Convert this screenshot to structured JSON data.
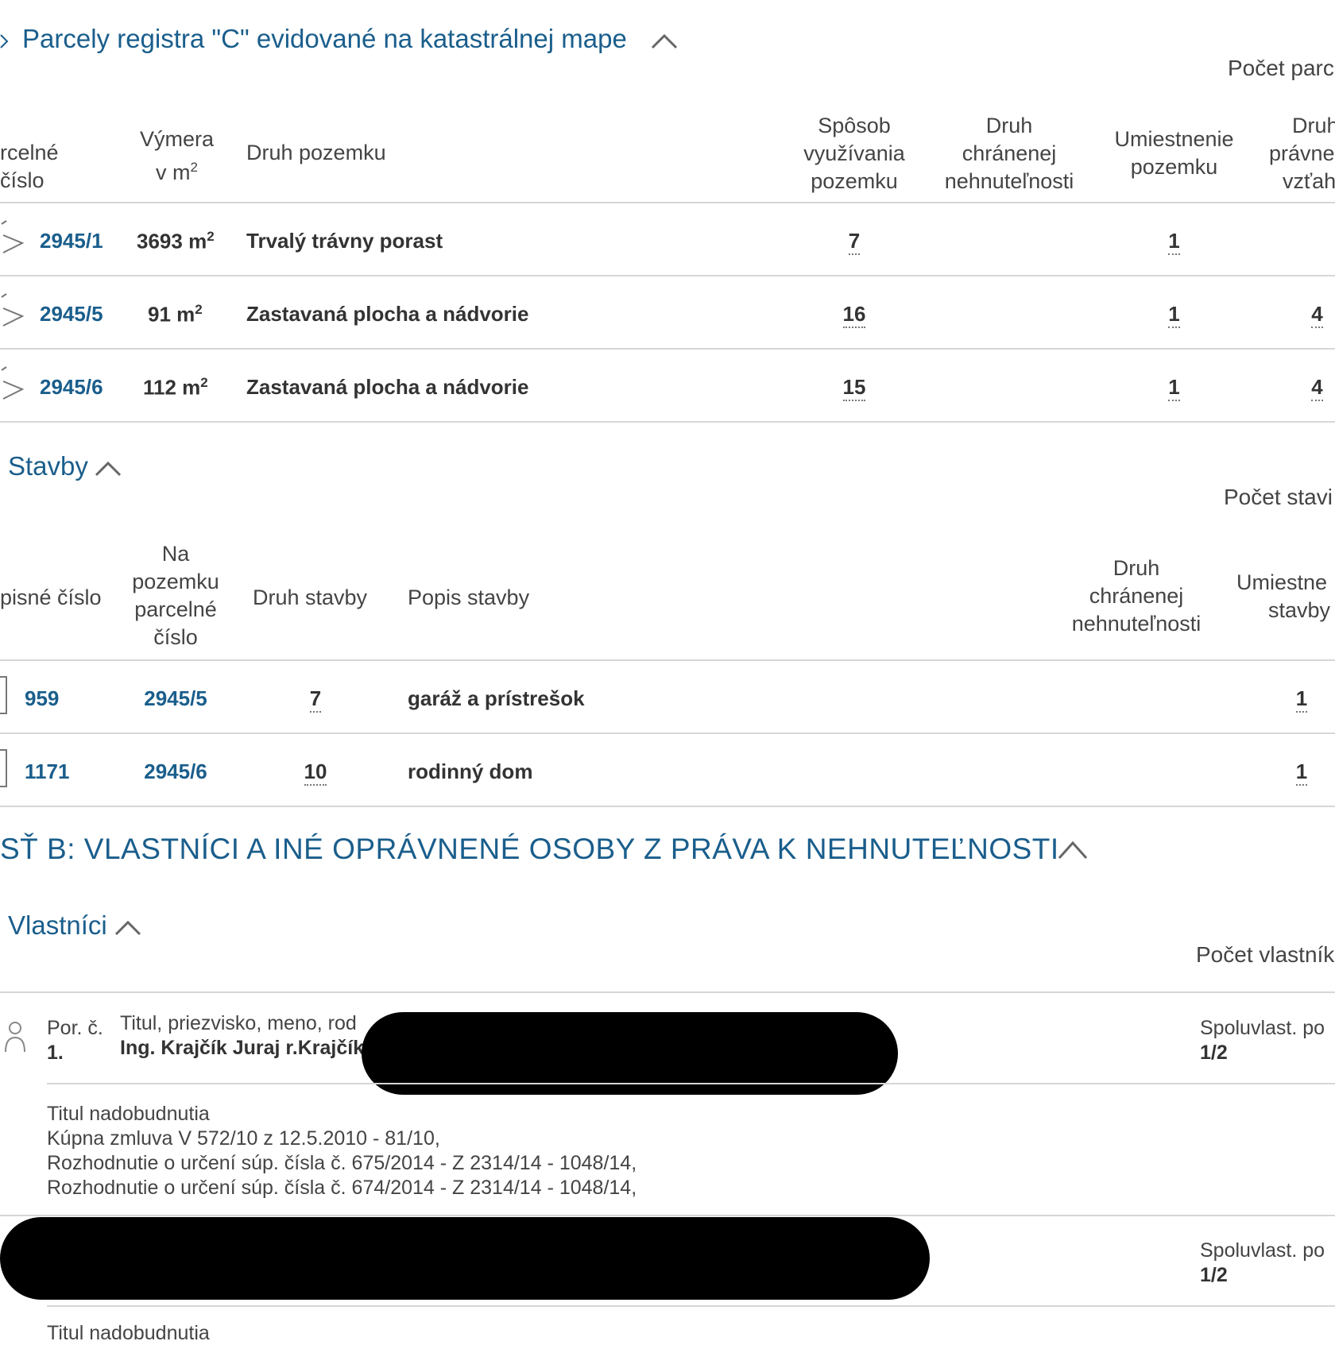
{
  "parcely": {
    "title": "Parcely registra \"C\" evidované na katastrálnej mape",
    "count_label": "Počet parc",
    "headers": {
      "parcelne_cislo": "rcelné číslo",
      "vymera_line1": "Výmera",
      "vymera_line2": "v m",
      "vymera_sup": "2",
      "druh_pozemku": "Druh pozemku",
      "sposob_1": "Spôsob",
      "sposob_2": "využívania",
      "sposob_3": "pozemku",
      "chranenej_1": "Druh",
      "chranenej_2": "chránenej",
      "chranenej_3": "nehnuteľnosti",
      "umiestnenie_1": "Umiestnenie",
      "umiestnenie_2": "pozemku",
      "pravneho_1": "Druh",
      "pravneho_2": "právne",
      "pravneho_3": "vzťah"
    },
    "rows": [
      {
        "cislo": "2945/1",
        "vymera": "3693 m",
        "sup": "2",
        "druh": "Trvalý trávny porast",
        "sposob": "7",
        "umiestnenie": "1",
        "pravny": ""
      },
      {
        "cislo": "2945/5",
        "vymera": "91 m",
        "sup": "2",
        "druh": "Zastavaná plocha a nádvorie",
        "sposob": "16",
        "umiestnenie": "1",
        "pravny": "4"
      },
      {
        "cislo": "2945/6",
        "vymera": "112 m",
        "sup": "2",
        "druh": "Zastavaná plocha a nádvorie",
        "sposob": "15",
        "umiestnenie": "1",
        "pravny": "4"
      }
    ]
  },
  "stavby": {
    "title": "Stavby",
    "count_label": "Počet stavi",
    "headers": {
      "supisne": "pisné číslo",
      "na_pozemku_1": "Na",
      "na_pozemku_2": "pozemku",
      "na_pozemku_3": "parcelné",
      "na_pozemku_4": "číslo",
      "druh_stavby": "Druh stavby",
      "popis_stavby": "Popis stavby",
      "chranenej_1": "Druh",
      "chranenej_2": "chránenej",
      "chranenej_3": "nehnuteľnosti",
      "umiestnenie_1": "Umiestne",
      "umiestnenie_2": "stavby"
    },
    "rows": [
      {
        "supisne": "959",
        "parcela": "2945/5",
        "druh": "7",
        "popis": "garáž a prístrešok",
        "umiestnenie": "1"
      },
      {
        "supisne": "1171",
        "parcela": "2945/6",
        "druh": "10",
        "popis": "rodinný dom",
        "umiestnenie": "1"
      }
    ]
  },
  "cast_b": {
    "title": "SŤ B: VLASTNÍCI A INÉ OPRÁVNENÉ OSOBY Z PRÁVA K NEHNUTEĽNOSTI"
  },
  "vlastnici": {
    "title": "Vlastníci",
    "count_label": "Počet vlastník",
    "owner1": {
      "por_label": "Por. č.",
      "por_value": "1.",
      "name_label": "Titul, priezvisko, meno, rod",
      "name_value": "Ing. Krajčík Juraj r.Krajčík",
      "share_label": "Spoluvlast. po",
      "share_value": "1/2",
      "titul_label": "Titul nadobudnutia",
      "titul_lines": [
        "Kúpna zmluva V 572/10 z 12.5.2010 - 81/10,",
        "Rozhodnutie o určení súp. čísla č. 675/2014 - Z 2314/14 - 1048/14,",
        "Rozhodnutie o určení súp. čísla č. 674/2014 - Z 2314/14 - 1048/14,"
      ]
    },
    "owner2": {
      "share_label": "Spoluvlast. po",
      "share_value": "1/2",
      "titul_label": "Titul nadobudnutia"
    }
  },
  "colors": {
    "accent": "#1a5e8c",
    "text": "#333333",
    "divider": "#d6d6d6",
    "redaction": "#000000"
  }
}
